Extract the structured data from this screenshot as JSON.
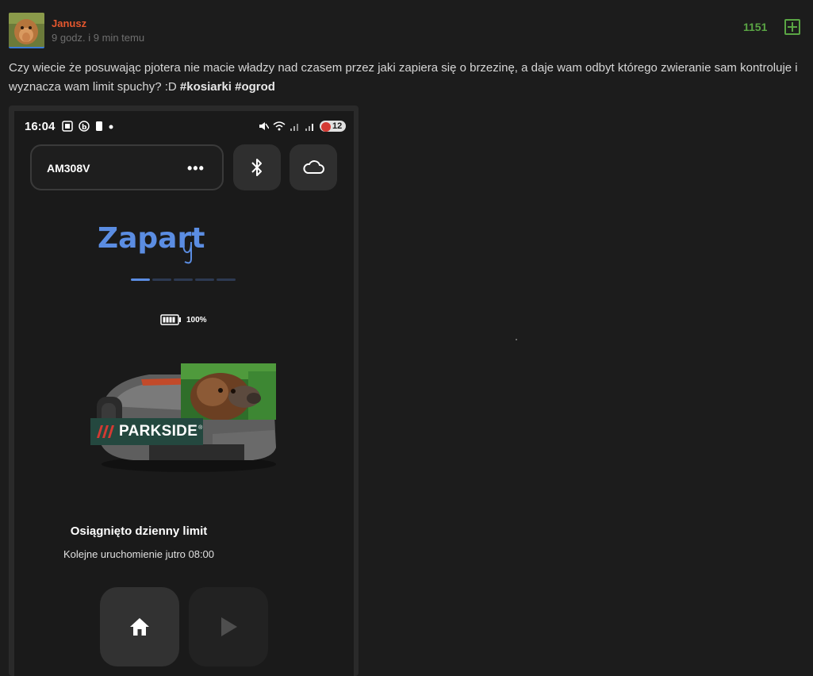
{
  "post": {
    "username": "Janusz",
    "timestamp": "9 godz. i 9 min temu",
    "votes": "1151",
    "text": "Czy wiecie że posuwając pjotera nie macie władzy nad czasem przez jaki zapiera się o brzezinę, a daje wam odbyt którego zwieranie sam kontroluje i wyznacza wam limit spuchy? :D",
    "tags": [
      "#kosiarki",
      "#ogrod"
    ]
  },
  "phone": {
    "status_time": "16:04",
    "notification_count": "12",
    "device_name": "AM308V",
    "more_label": "•••",
    "state_label": "Zapart",
    "state_scribble": "y",
    "progress_active_index": 0,
    "progress_segments": 5,
    "battery_level": "100%",
    "brand_label": "PARKSIDE",
    "brand_reg": "®",
    "limit_title": "Osiągnięto dzienny limit",
    "limit_subtitle": "Kolejne uruchomienie jutro 08:00"
  },
  "colors": {
    "background": "#1c1c1c",
    "username": "#e4572e",
    "votes": "#5aa544",
    "accent_blue": "#5b8de2",
    "brand_green": "#24483f"
  },
  "icons": {
    "plus": "plus-square-icon",
    "bluetooth": "bluetooth-icon",
    "cloud": "cloud-icon",
    "home": "home-icon",
    "play": "play-icon",
    "battery": "battery-icon"
  }
}
